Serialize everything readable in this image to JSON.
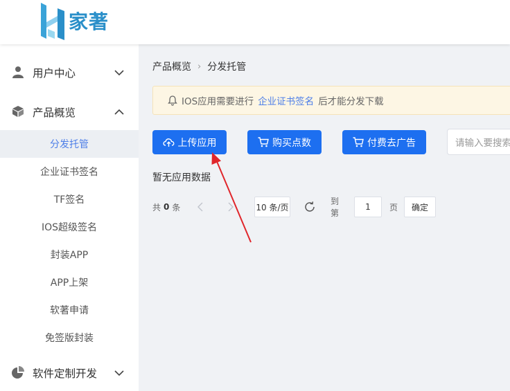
{
  "brand": {
    "name": "家著"
  },
  "sidebar": {
    "groups": [
      {
        "label": "用户中心",
        "icon": "user-icon"
      },
      {
        "label": "产品概览",
        "icon": "cube-icon"
      },
      {
        "label": "软件定制开发",
        "icon": "pie-chart-icon"
      }
    ],
    "sub_items": [
      "分发托管",
      "企业证书签名",
      "TF签名",
      "IOS超级签名",
      "封装APP",
      "APP上架",
      "软著申请",
      "免签版封装"
    ],
    "active_sub": "分发托管"
  },
  "breadcrumb": {
    "parent": "产品概览",
    "current": "分发托管"
  },
  "notice": {
    "before": "IOS应用需要进行",
    "link": "企业证书签名",
    "after": "后才能分发下载",
    "icon": "bell-icon"
  },
  "actions": {
    "upload": "上传应用",
    "buy_points": "购买点数",
    "remove_ads": "付费去广告"
  },
  "search": {
    "placeholder": "请输入要搜索"
  },
  "empty_text": "暂无应用数据",
  "pagination": {
    "total_prefix": "共",
    "total": "0",
    "total_suffix": "条",
    "page_size": "10 条/页",
    "goto_prefix": "到第",
    "goto_value": "1",
    "goto_suffix": "页",
    "confirm": "确定"
  },
  "colors": {
    "primary": "#1d6ff0",
    "link": "#4e7fe8",
    "annotation_arrow": "#e0262b",
    "notice_bg": "#fdf6e4"
  }
}
